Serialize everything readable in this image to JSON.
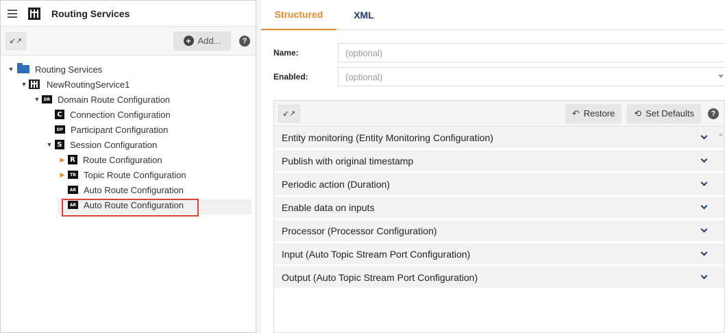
{
  "header": {
    "title": "Routing Services"
  },
  "toolbar": {
    "expand_icon": "↙↗",
    "add_label": "Add...",
    "help": "?"
  },
  "tree": {
    "items": [
      {
        "label": "Routing Services",
        "icon": "folder-icon"
      },
      {
        "label": "NewRoutingService1",
        "icon": "routing-service-icon"
      },
      {
        "label": "Domain Route Configuration",
        "badge": "DR"
      },
      {
        "label": "Connection Configuration",
        "badge": "C"
      },
      {
        "label": "Participant Configuration",
        "badge": "DP"
      },
      {
        "label": "Session Configuration",
        "badge": "S"
      },
      {
        "label": "Route Configuration",
        "badge": "R"
      },
      {
        "label": "Topic Route Configuration",
        "badge": "TR"
      },
      {
        "label": "Auto Route Configuration",
        "badge": "AR"
      },
      {
        "label": "Auto Route Configuration",
        "badge": "AR",
        "selected": true
      }
    ]
  },
  "tabs": [
    {
      "label": "Structured",
      "active": true
    },
    {
      "label": "XML",
      "active": false
    }
  ],
  "form": {
    "name_label": "Name:",
    "name_placeholder": "(optional)",
    "enabled_label": "Enabled:",
    "enabled_placeholder": "(optional)"
  },
  "panel": {
    "expand_icon": "↙↗",
    "restore_label": "Restore",
    "set_defaults_label": "Set Defaults",
    "help": "?",
    "sections": [
      "Entity monitoring (Entity Monitoring Configuration)",
      "Publish with original timestamp",
      "Periodic action (Duration)",
      "Enable data on inputs",
      "Processor (Processor Configuration)",
      "Input (Auto Topic Stream Port Configuration)",
      "Output (Auto Topic Stream Port Configuration)"
    ]
  },
  "colors": {
    "accent": "#e08a2c",
    "link": "#1a3a6e",
    "selection_border": "#e0403a"
  }
}
